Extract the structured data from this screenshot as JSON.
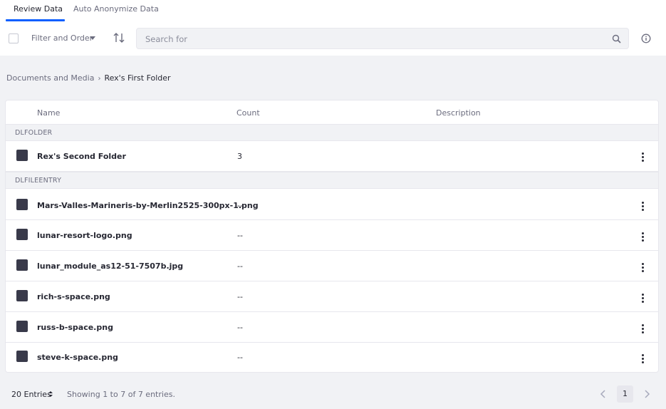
{
  "tabs": [
    {
      "label": "Review Data",
      "active": true
    },
    {
      "label": "Auto Anonymize Data",
      "active": false
    }
  ],
  "toolbar": {
    "filter_label": "Filter and Order",
    "search_placeholder": "Search for"
  },
  "breadcrumb": {
    "items": [
      "Documents and Media",
      "Rex's First Folder"
    ]
  },
  "table": {
    "columns": [
      "Name",
      "Count",
      "Description"
    ],
    "groups": [
      {
        "label": "DLFOLDER",
        "rows": [
          {
            "name": "Rex's Second Folder",
            "count": "3",
            "description": ""
          }
        ]
      },
      {
        "label": "DLFILEENTRY",
        "rows": [
          {
            "name": "Mars-Valles-Marineris-by-Merlin2525-300px-1.png",
            "count": "--",
            "description": ""
          },
          {
            "name": "lunar-resort-logo.png",
            "count": "--",
            "description": ""
          },
          {
            "name": "lunar_module_as12-51-7507b.jpg",
            "count": "--",
            "description": ""
          },
          {
            "name": "rich-s-space.png",
            "count": "--",
            "description": ""
          },
          {
            "name": "russ-b-space.png",
            "count": "--",
            "description": ""
          },
          {
            "name": "steve-k-space.png",
            "count": "--",
            "description": ""
          }
        ]
      }
    ]
  },
  "footer": {
    "entries_label": "20 Entries",
    "showing_text": "Showing 1 to 7 of 7 entries.",
    "current_page": "1"
  },
  "colors": {
    "accent": "#0b5fff",
    "background": "#f1f2f5",
    "text": "#272833",
    "muted": "#6b6c7e"
  }
}
